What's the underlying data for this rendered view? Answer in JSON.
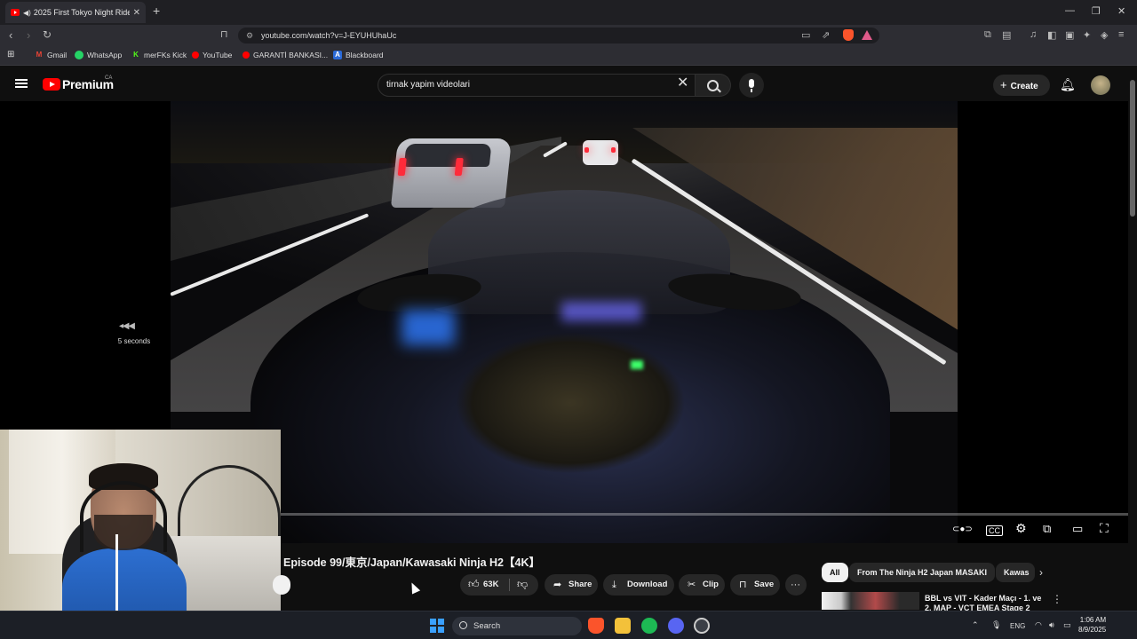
{
  "browser": {
    "tab_title": "2025 First Tokyo Night Ride",
    "url": "youtube.com/watch?v=J-EYUHUhaUc",
    "bookmarks": [
      {
        "label": "Gmail",
        "icon": "gmail-icon",
        "color": "#ea4335"
      },
      {
        "label": "WhatsApp",
        "icon": "whatsapp-icon",
        "color": "#25d366"
      },
      {
        "label": "merFKs Kick",
        "icon": "kick-icon",
        "color": "#53fc18"
      },
      {
        "label": "YouTube",
        "icon": "youtube-icon",
        "color": "#ff0000"
      },
      {
        "label": "GARANTİ BANKASI...",
        "icon": "bank-icon",
        "color": "#ff0000"
      },
      {
        "label": "Blackboard",
        "icon": "blackboard-icon",
        "color": "#2a6ad8"
      }
    ]
  },
  "youtube": {
    "brand": "Premium",
    "region": "CA",
    "search_query": "tirnak yapim videolari",
    "create_label": "Create"
  },
  "player": {
    "skip_label": "5 seconds",
    "progress": 0.0
  },
  "video": {
    "title": "Episode 99/東京/Japan/Kawasaki Ninja H2【4K】",
    "like_count": "63K",
    "share_label": "Share",
    "download_label": "Download",
    "clip_label": "Clip",
    "save_label": "Save"
  },
  "chips": [
    "All",
    "From The Ninja H2 Japan MASAKI",
    "Kawas"
  ],
  "recommendation": {
    "title": "BBL vs VIT - Kader Maçı - 1. ve 2. MAP - VCT EMEA Stage 2"
  },
  "taskbar": {
    "search_label": "Search",
    "language": "ENG",
    "time": "1:06 AM",
    "date": "8/9/2025"
  }
}
